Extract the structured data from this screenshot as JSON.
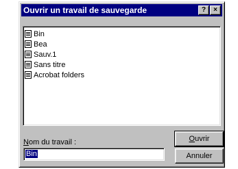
{
  "window": {
    "title": "Ouvrir un travail de sauvegarde",
    "help_label": "?",
    "close_label": "×"
  },
  "list": {
    "items": [
      {
        "label": "Bin",
        "icon": "document-icon"
      },
      {
        "label": "Bea",
        "icon": "document-icon"
      },
      {
        "label": "Sauv.1",
        "icon": "document-icon"
      },
      {
        "label": "Sans titre",
        "icon": "document-icon"
      },
      {
        "label": "Acrobat folders",
        "icon": "document-icon"
      }
    ]
  },
  "form": {
    "name_label_key": "N",
    "name_label_rest": "om du travail :",
    "name_value": "Bin"
  },
  "buttons": {
    "open_key": "O",
    "open_rest": "uvrir",
    "cancel_label": "Annuler"
  },
  "colors": {
    "titlebar": "#000080",
    "face": "#c0c0c0",
    "selection": "#000080"
  }
}
